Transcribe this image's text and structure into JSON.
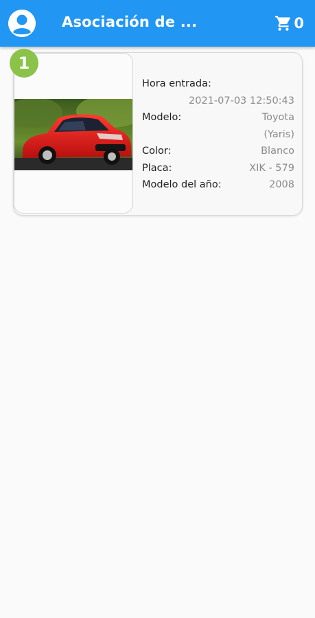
{
  "app": {
    "title": "Asociación de ...",
    "cart_count": "0",
    "colors": {
      "primary": "#2196f3",
      "badge": "#8bc34a"
    },
    "icons": {
      "profile": "account-circle-icon",
      "cart": "shopping-cart-icon"
    }
  },
  "vehicles": [
    {
      "index": "1",
      "entry_label": "Hora entrada:",
      "entry_value": "2021-07-03 12:50:43",
      "model_label": "Modelo:",
      "model_line1": "Toyota",
      "model_line2": "(Yaris)",
      "color_label": "Color:",
      "color_value": "Blanco",
      "plate_label": "Placa:",
      "plate_value": "XIK - 579",
      "year_label": "Modelo del año:",
      "year_value": "2008"
    }
  ]
}
